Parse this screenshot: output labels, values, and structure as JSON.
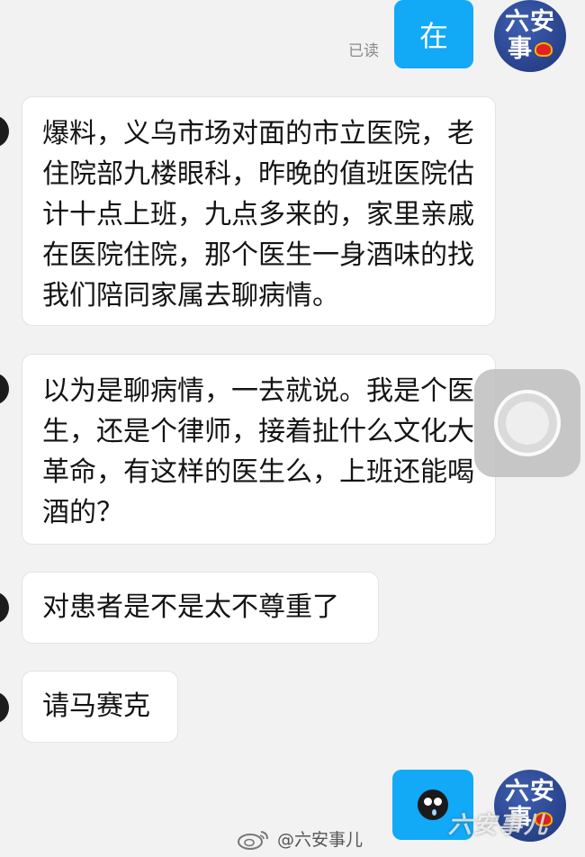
{
  "conversation": {
    "read_status": "已读",
    "messages": [
      {
        "sender": "me",
        "text": "在"
      },
      {
        "sender": "other",
        "text": "爆料，义乌市场对面的市立医院，老住院部九楼眼科，昨晚的值班医院估计十点上班，九点多来的，家里亲戚在医院住院，那个医生一身酒味的找我们陪同家属去聊病情。"
      },
      {
        "sender": "other",
        "text": "以为是聊病情，一去就说。我是个医生，还是个律师，接着扯什么文化大革命，有这样的医生么，上班还能喝酒的？"
      },
      {
        "sender": "other",
        "text": "对患者是不是太不尊重了"
      },
      {
        "sender": "other",
        "text": "请马赛克"
      },
      {
        "sender": "me",
        "text": "",
        "icon": "crying-emoji-icon"
      }
    ]
  },
  "avatar": {
    "line1": "六安",
    "line2": "事"
  },
  "watermark": {
    "left_text": "@六安事儿",
    "right_text": "六安事儿"
  },
  "colors": {
    "background": "#f2f2f2",
    "my_bubble": "#12a9f7",
    "other_bubble": "#ffffff"
  }
}
